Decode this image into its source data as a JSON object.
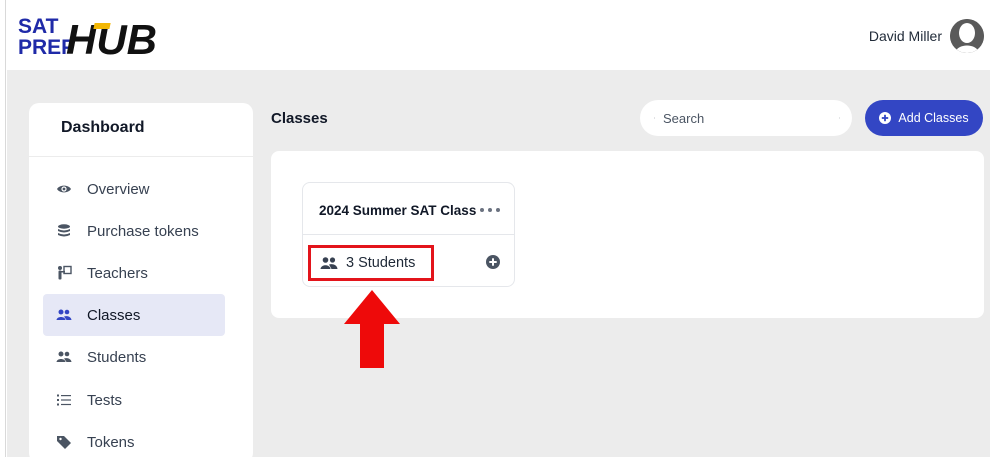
{
  "header": {
    "logo": {
      "line1": "SAT",
      "line2": "PREP",
      "word": "HUB"
    },
    "user_name": "David Miller"
  },
  "sidebar": {
    "title": "Dashboard",
    "items": [
      {
        "label": "Overview",
        "icon": "eye-icon",
        "active": false
      },
      {
        "label": "Purchase tokens",
        "icon": "coins-icon",
        "active": false
      },
      {
        "label": "Teachers",
        "icon": "teacher-icon",
        "active": false
      },
      {
        "label": "Classes",
        "icon": "users-icon",
        "active": true
      },
      {
        "label": "Students",
        "icon": "users-icon",
        "active": false
      },
      {
        "label": "Tests",
        "icon": "list-icon",
        "active": false
      },
      {
        "label": "Tokens",
        "icon": "tag-icon",
        "active": false
      }
    ]
  },
  "main": {
    "title": "Classes",
    "search": {
      "placeholder": "Search",
      "value": ""
    },
    "add_button_label": "Add Classes",
    "classes": [
      {
        "name": "2024 Summer SAT Class",
        "students_label": "3 Students"
      }
    ]
  },
  "colors": {
    "accent": "#3346c4",
    "active_nav_bg": "#e6e8f6",
    "highlight": "#e3141b",
    "logo_yellow": "#f2b705",
    "logo_blue": "#1f2aa8"
  }
}
